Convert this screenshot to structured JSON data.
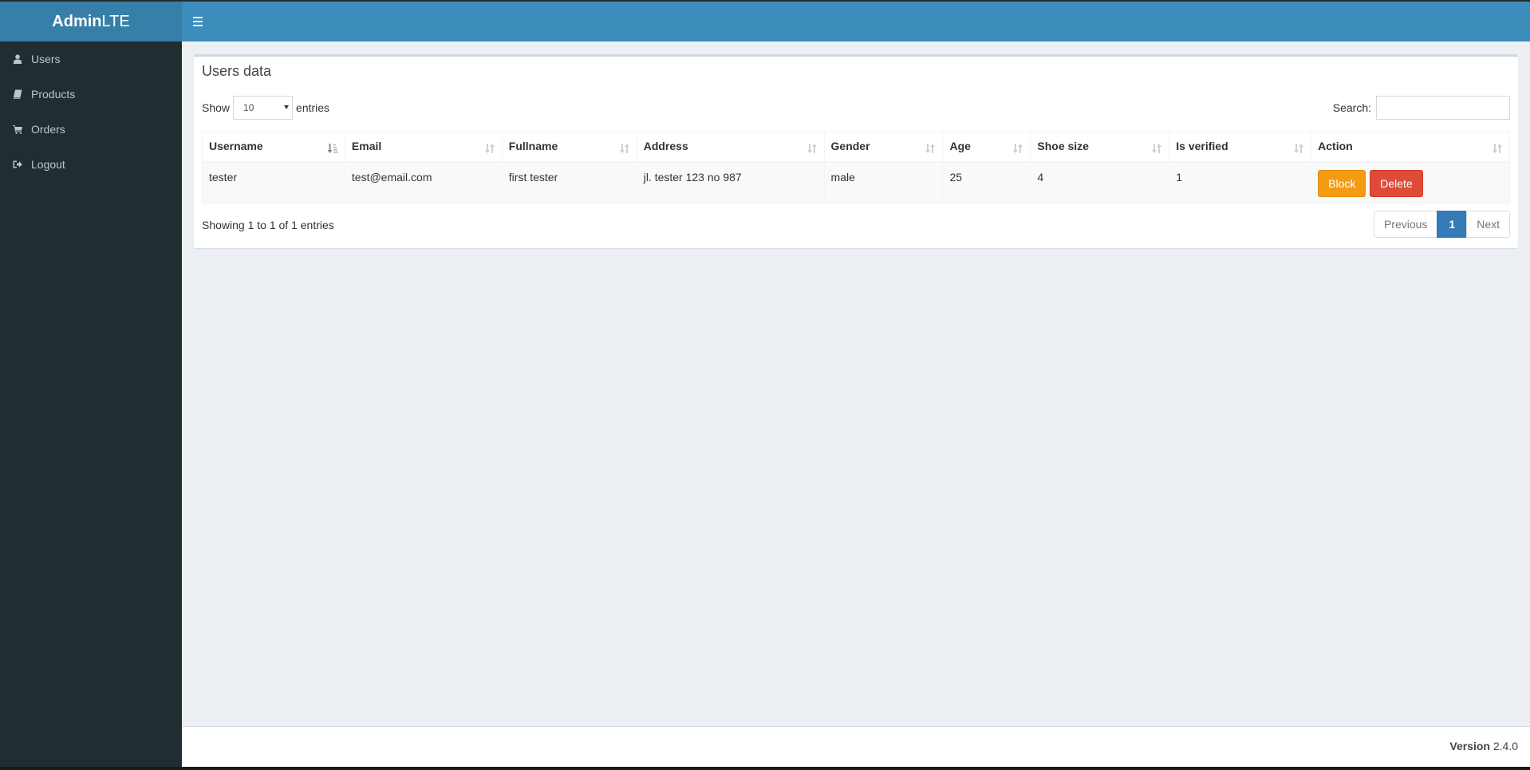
{
  "app": {
    "logo_bold": "Admin",
    "logo_light": "LTE"
  },
  "navbar": {
    "toggle_icon": "hamburger-icon"
  },
  "sidebar": {
    "items": [
      {
        "label": "Users",
        "icon": "user-icon"
      },
      {
        "label": "Products",
        "icon": "book-icon"
      },
      {
        "label": "Orders",
        "icon": "shopping-cart-icon"
      },
      {
        "label": "Logout",
        "icon": "sign-out-icon"
      }
    ]
  },
  "box": {
    "title": "Users data",
    "length": {
      "show_label": "Show",
      "selected": "10",
      "entries_label": "entries"
    },
    "search": {
      "label": "Search:",
      "value": "",
      "placeholder": ""
    },
    "table": {
      "columns": [
        "Username",
        "Email",
        "Fullname",
        "Address",
        "Gender",
        "Age",
        "Shoe size",
        "Is verified",
        "Action"
      ],
      "sorted_column": "Username",
      "sort_direction": "ascending",
      "rows": [
        {
          "username": "tester",
          "email": "test@email.com",
          "fullname": "first tester",
          "address": "jl. tester 123 no 987",
          "gender": "male",
          "age": "25",
          "shoe_size": "4",
          "is_verified": "1",
          "actions": {
            "block": "Block",
            "delete": "Delete"
          }
        }
      ]
    },
    "info": "Showing 1 to 1 of 1 entries",
    "pagination": {
      "previous": "Previous",
      "current": "1",
      "next": "Next"
    }
  },
  "footer": {
    "version_label": "Version",
    "version_value": "2.4.0"
  },
  "colors": {
    "header_blue": "#3c8dbc",
    "logo_blue": "#367fa9",
    "sidebar_dark": "#222d32",
    "content_bg": "#ecf0f5",
    "warning": "#f39c12",
    "danger": "#dd4b39",
    "primary": "#337ab7"
  }
}
